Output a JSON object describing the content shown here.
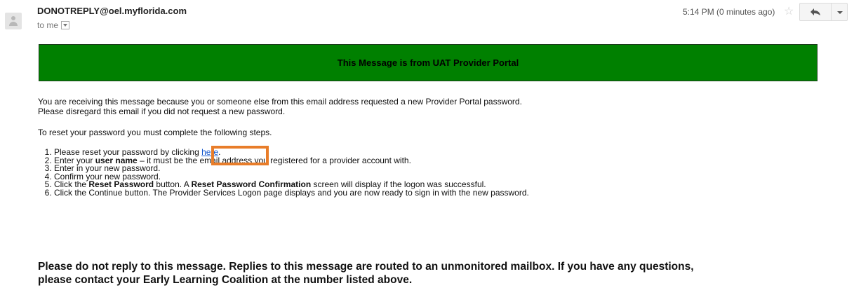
{
  "header": {
    "sender": "DONOTREPLY@oel.myflorida.com",
    "to_label": "to me",
    "timestamp": "5:14 PM (0 minutes ago)",
    "icons": {
      "avatar": "person-icon",
      "star": "star-icon",
      "reply": "reply-arrow-icon",
      "more": "chevron-down-icon"
    }
  },
  "banner": {
    "text": "This Message is from UAT Provider Portal",
    "bg_color": "#008000"
  },
  "body": {
    "para1": [
      "You are receiving this message because you or someone else from this email address requested a new Provider Portal password.",
      "Please disregard this email if you did not request a new password."
    ],
    "para2": "To reset your password you must complete the following steps.",
    "steps": {
      "s1_pre": "Please reset your password by clicking ",
      "s1_link": "here",
      "s1_post": ".",
      "s2_pre": "Enter your ",
      "s2_bold": "user name",
      "s2_post": " – it must be the email address you registered for a provider account with.",
      "s3": "Enter in your new password.",
      "s4": "Confirm your new password.",
      "s5_pre": "Click the ",
      "s5_bold1": "Reset Password",
      "s5_mid": " button. A ",
      "s5_bold2": "Reset Password Confirmation",
      "s5_post": " screen will display if the logon was successful.",
      "s6": "Click the Continue button. The Provider Services Logon page displays and you are now ready to sign in with the new password."
    }
  },
  "footer": [
    "Please do not reply to this message. Replies to this message are routed to an unmonitored mailbox. If you have any questions,",
    "please contact your Early Learning Coalition at the number listed above."
  ],
  "colors": {
    "link": "#1155cc",
    "highlight": "#e87d2a"
  }
}
